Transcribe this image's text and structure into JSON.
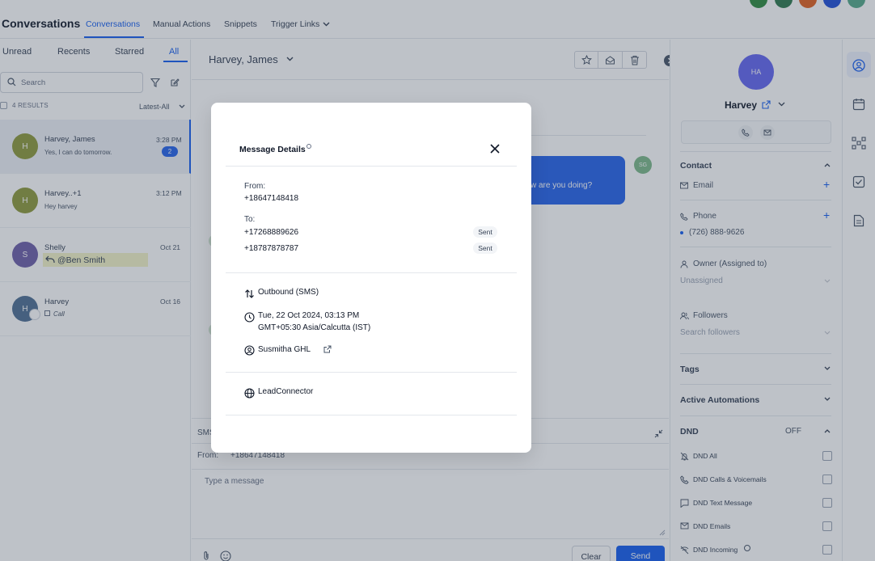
{
  "header": {
    "app_title": "Conversations",
    "tabs": [
      {
        "label": "Conversations"
      },
      {
        "label": "Manual Actions"
      },
      {
        "label": "Snippets"
      },
      {
        "label": "Trigger Links"
      }
    ]
  },
  "list": {
    "filters": [
      {
        "label": "Unread"
      },
      {
        "label": "Recents"
      },
      {
        "label": "Starred"
      },
      {
        "label": "All"
      }
    ],
    "search_placeholder": "Search",
    "results_count": "4 RESULTS",
    "sort_label": "Latest-All",
    "conversations": [
      {
        "initial": "H",
        "name": "Harvey, James",
        "snippet": "Yes, I can do tomorrow.",
        "time": "3:28 PM",
        "unread": "2"
      },
      {
        "initial": "H",
        "name": "Harvey..+1",
        "snippet": "Hey harvey",
        "time": "3:12 PM"
      },
      {
        "initial": "S",
        "name": "Shelly",
        "snippet": "@Ben Smith",
        "time": "Oct 21"
      },
      {
        "initial": "H",
        "name": "Harvey",
        "snippet": "Call",
        "time": "Oct 16"
      }
    ]
  },
  "conversation": {
    "title": "Harvey, James",
    "bubble_text": "w are you doing?",
    "bubble_avatar": "SG",
    "channel": "SMS",
    "from_label": "From:",
    "from_number": "+18647148418",
    "compose_placeholder": "Type a message",
    "clear_label": "Clear",
    "send_label": "Send"
  },
  "contact": {
    "initials": "HA",
    "name": "Harvey",
    "contact_section": "Contact",
    "email_label": "Email",
    "phone_label": "Phone",
    "phone_value": "(726) 888-9626",
    "owner_label": "Owner (Assigned to)",
    "owner_value": "Unassigned",
    "followers_label": "Followers",
    "followers_placeholder": "Search followers",
    "tags_section": "Tags",
    "automations_section": "Active Automations",
    "dnd_section": "DND",
    "dnd_status": "OFF",
    "dnd_items": [
      {
        "label": "DND All"
      },
      {
        "label": "DND Calls & Voicemails"
      },
      {
        "label": "DND Text Message"
      },
      {
        "label": "DND Emails"
      },
      {
        "label": "DND Incoming"
      }
    ]
  },
  "modal": {
    "title": "Message Details",
    "from_label": "From:",
    "from_number": "+18647148418",
    "to_label": "To:",
    "recipients": [
      {
        "number": "+17268889626",
        "status": "Sent"
      },
      {
        "number": "+18787878787",
        "status": "Sent"
      }
    ],
    "direction": "Outbound (SMS)",
    "datetime": "Tue, 22 Oct 2024, 03:13 PM",
    "timezone": "GMT+05:30 Asia/Calcutta (IST)",
    "sender": "Susmitha GHL",
    "provider": "LeadConnector"
  },
  "colors": {
    "accent": "#155eef",
    "overlay": "#344054",
    "avatar_olive": "#8e9a3c",
    "avatar_purple": "#6e5fa8",
    "avatar_slate": "#4f6f94"
  }
}
